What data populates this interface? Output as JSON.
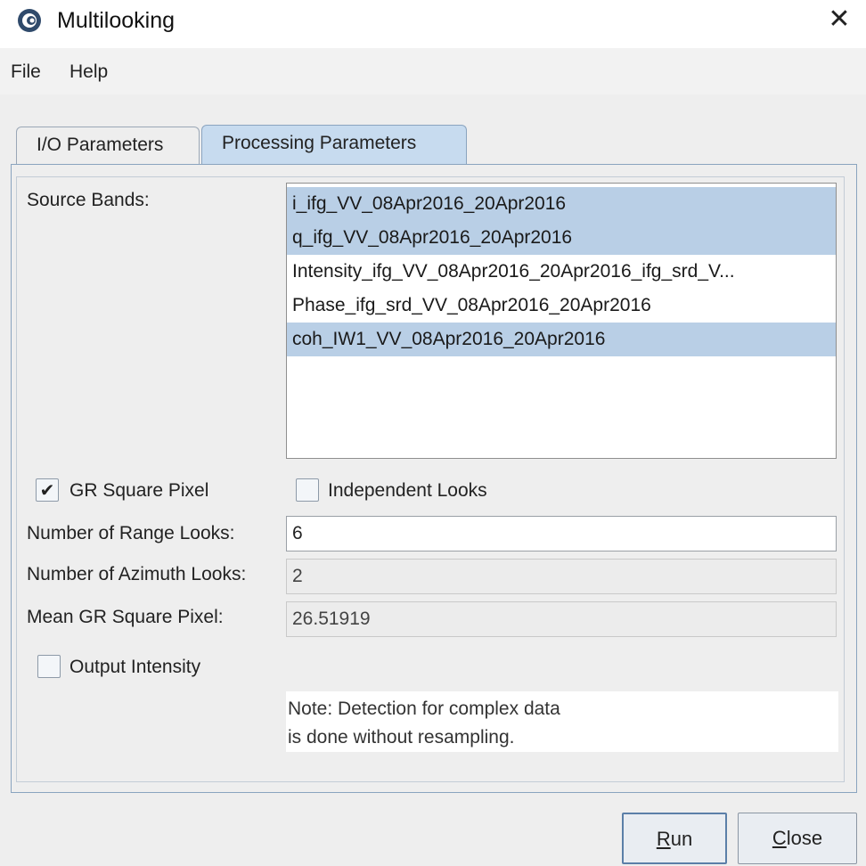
{
  "window": {
    "title": "Multilooking",
    "close_symbol": "✕",
    "app_icon": "esa-snap-logo-icon"
  },
  "menu": {
    "items": [
      {
        "label": "File"
      },
      {
        "label": "Help"
      }
    ]
  },
  "tabs": [
    {
      "label": "I/O Parameters",
      "active": false
    },
    {
      "label": "Processing Parameters",
      "active": true
    }
  ],
  "processing": {
    "source_bands_label": "Source Bands:",
    "source_bands": [
      {
        "label": "i_ifg_VV_08Apr2016_20Apr2016",
        "selected": true
      },
      {
        "label": "q_ifg_VV_08Apr2016_20Apr2016",
        "selected": true
      },
      {
        "label": "Intensity_ifg_VV_08Apr2016_20Apr2016_ifg_srd_V...",
        "selected": false
      },
      {
        "label": "Phase_ifg_srd_VV_08Apr2016_20Apr2016",
        "selected": false
      },
      {
        "label": "coh_IW1_VV_08Apr2016_20Apr2016",
        "selected": true
      }
    ],
    "gr_square_pixel": {
      "label": "GR Square Pixel",
      "checked": true,
      "check_symbol": "✔"
    },
    "independent_looks": {
      "label": "Independent Looks",
      "checked": false
    },
    "range_looks": {
      "label": "Number of Range Looks:",
      "value": "6"
    },
    "azimuth_looks": {
      "label": "Number of Azimuth Looks:",
      "value": "2"
    },
    "mean_gr_square_pixel": {
      "label": "Mean GR Square Pixel:",
      "value": "26.51919"
    },
    "output_intensity": {
      "label": "Output Intensity",
      "checked": false
    },
    "note_line1": "Note: Detection for complex data",
    "note_line2": "is done without resampling."
  },
  "buttons": {
    "run": {
      "mnemonic": "R",
      "rest": "un"
    },
    "close": {
      "mnemonic": "C",
      "rest": "lose"
    }
  },
  "colors": {
    "selection": "#b9cfe6",
    "active_tab": "#c7dbef",
    "panel_border": "#8aa4bf"
  }
}
